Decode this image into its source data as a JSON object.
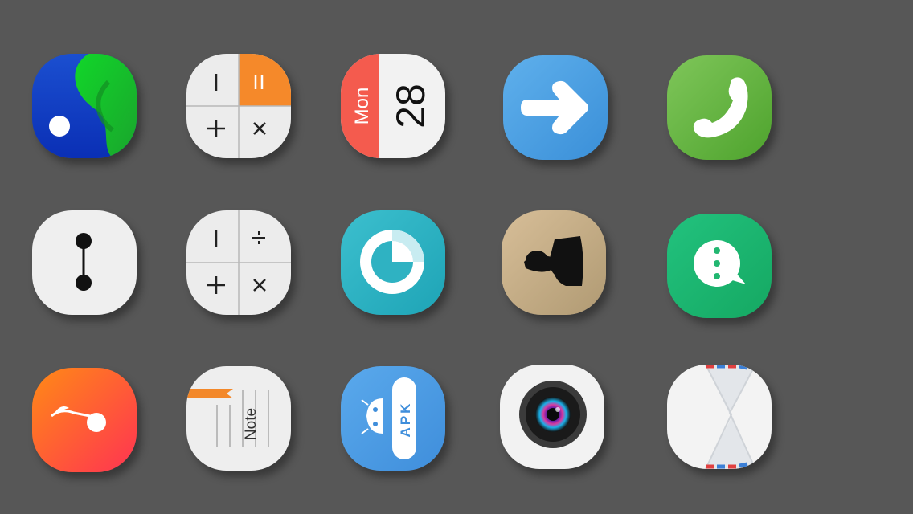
{
  "calendar": {
    "day": "Mon",
    "date": "28"
  },
  "apk": {
    "label": "APK"
  },
  "note": {
    "label": "Note"
  },
  "icons": [
    {
      "name": "maps-app-icon"
    },
    {
      "name": "calculator-app-icon"
    },
    {
      "name": "calendar-app-icon"
    },
    {
      "name": "arrow-app-icon"
    },
    {
      "name": "phone-app-icon"
    },
    {
      "name": "link-app-icon"
    },
    {
      "name": "calculator-alt-app-icon"
    },
    {
      "name": "timer-app-icon"
    },
    {
      "name": "contacts-app-icon"
    },
    {
      "name": "messages-app-icon"
    },
    {
      "name": "cleaner-app-icon"
    },
    {
      "name": "notes-app-icon"
    },
    {
      "name": "apk-installer-app-icon"
    },
    {
      "name": "camera-app-icon"
    },
    {
      "name": "mail-app-icon"
    }
  ]
}
